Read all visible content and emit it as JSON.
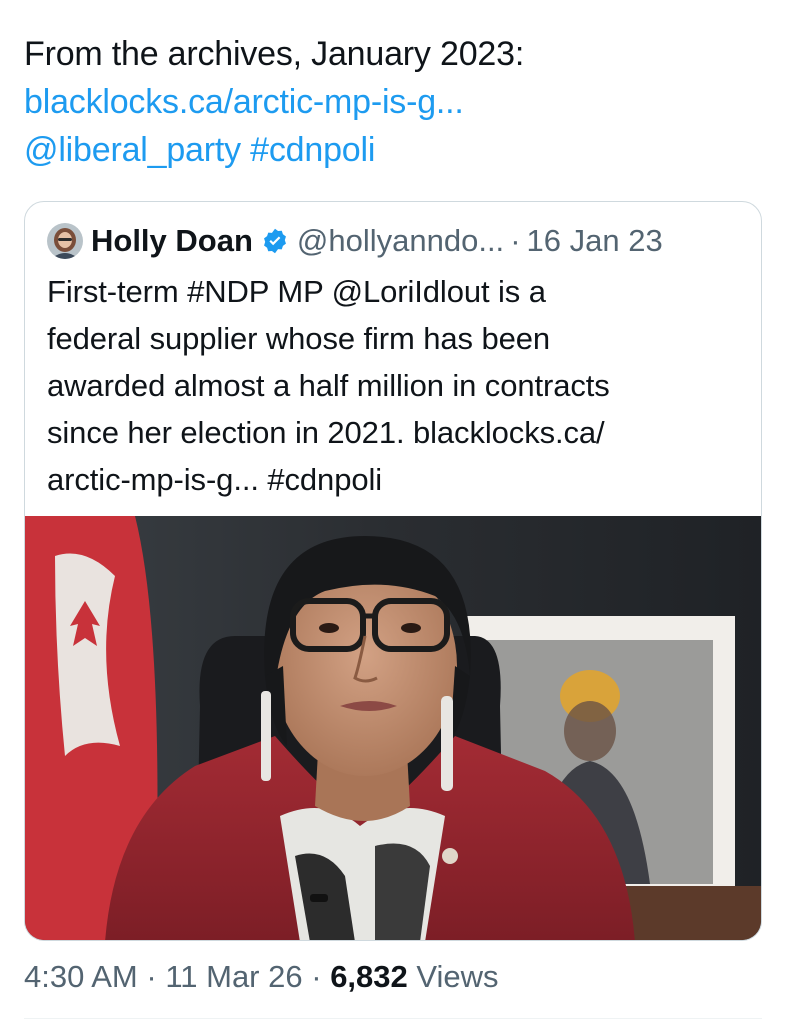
{
  "tweet": {
    "line1": "From the archives, January 2023:",
    "link": "blacklocks.ca/arctic-mp-is-g...",
    "mention": "@liberal_party",
    "hashtag": "#cdnpoli"
  },
  "quoted_tweet": {
    "author_name": "Holly Doan",
    "handle": "@hollyanndo...",
    "separator": "·",
    "date": "16 Jan 23",
    "text_lines": [
      "First-term #NDP MP @LoriIdlout is a",
      "federal supplier whose firm has been",
      "awarded almost a half million in contracts",
      "since her election in 2021. blacklocks.ca/",
      "arctic-mp-is-g... #cdnpoli"
    ],
    "image_icon": "photo-of-woman-in-red-blazer"
  },
  "meta": {
    "time": "4:30 AM",
    "separator": "·",
    "date": "11 Mar 26",
    "views_count": "6,832",
    "views_label": "Views"
  },
  "colors": {
    "link": "#1d9bf0",
    "text": "#0f1419",
    "secondary": "#536471",
    "border": "#cfd9de",
    "verified": "#1d9bf0"
  }
}
